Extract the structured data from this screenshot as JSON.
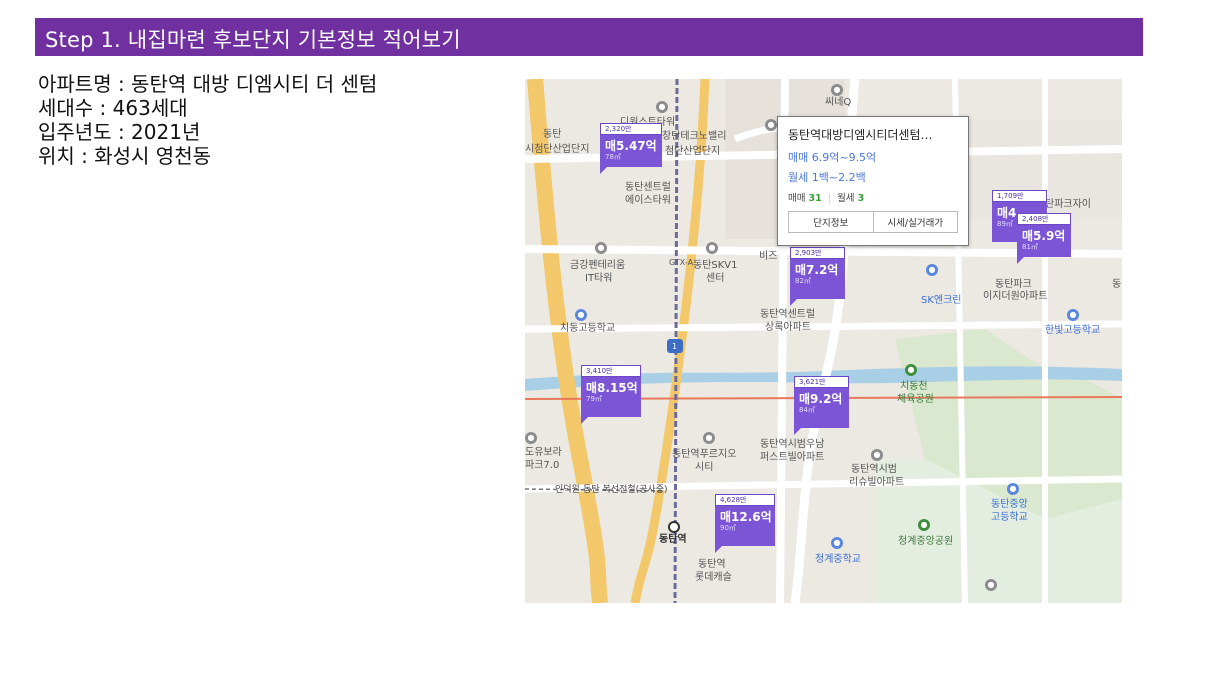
{
  "header": {
    "title": "Step 1. 내집마련 후보단지 기본정보 적어보기"
  },
  "info": {
    "apartment": "아파트명 : 동탄역 대방 디엠시티 더 센텀",
    "households": "세대수 : 463세대",
    "move_in": "입주년도 : 2021년",
    "location": "위치 : 화성시 영천동"
  },
  "popup": {
    "name": "동탄역대방디엠시티더센텀…",
    "sale_range": "매매 6.9억~9.5억",
    "rent_range": "월세 1백~2.2백",
    "sale_label": "매매",
    "sale_count": "31",
    "rent_label": "월세",
    "rent_count": "3",
    "btn_info": "단지정보",
    "btn_price": "시세/실거래가"
  },
  "markers": [
    {
      "count": "2,320만",
      "price": "매5.47억",
      "area": "78㎡"
    },
    {
      "count": "2,903만",
      "price": "매7.2억",
      "area": "82㎡"
    },
    {
      "count": "1,709만",
      "price": "매4",
      "area": "89㎡"
    },
    {
      "count": "2,408만",
      "price": "매5.9억",
      "area": "81㎡"
    },
    {
      "count": "3,410만",
      "price": "매8.15억",
      "area": "79㎡"
    },
    {
      "count": "3,621만",
      "price": "매9.2억",
      "area": "84㎡"
    },
    {
      "count": "4,628만",
      "price": "매12.6억",
      "area": "90㎡"
    }
  ],
  "map_labels": {
    "sineq": "씨네Q",
    "dongtan_industrial_1": "동탄",
    "dongtan_industrial_2": "시첨단산업단지",
    "tower": "디원스트타워",
    "techno": "창탄테크노밸리",
    "hightech": "첨단산업단지",
    "center": "동탄센트럴",
    "ace": "에이스타워",
    "sk": "동탄SKV1",
    "sk2": "센터",
    "geumgang": "금강펜테리움",
    "geumgang2": "IT타워",
    "gtx": "GTX-A",
    "chidong_high": "치동고등학교",
    "central_sangrok": "동탄역센트럴",
    "central_sangrok2": "상록아파트",
    "sk_encrin": "SK엔크린",
    "park_ei": "동탄파크",
    "park_ei2": "이지더원아파트",
    "hanbit": "한빛고등학교",
    "chidong_sports": "치동천",
    "chidong_sports2": "체육공원",
    "bura": "동탄역시범우남",
    "bura2": "퍼스트빌아파트",
    "prugio": "동탄역푸르지오",
    "prugio2": "시티",
    "riche": "동탄역시범",
    "riche2": "리슈빌아파트",
    "railway": "인덕원-동탄 복선전철(공사중)",
    "station": "동탄역",
    "lotte": "동탄역",
    "lotte2": "롯데캐슬",
    "yubora": "도유보라",
    "yubora2": "파크7.0",
    "jungang_high": "동탄중앙",
    "jungang_high2": "고등학교",
    "cheonggye_park": "청계중앙공원",
    "cheonggye_mid": "청계중학교",
    "biz": "비즈",
    "parkxi": "탄파크자이",
    "dong_right": "동",
    "route": "1"
  },
  "colors": {
    "title_bar": "#7030a0",
    "marker": "#7b55d6",
    "link_blue": "#4b78d8"
  }
}
